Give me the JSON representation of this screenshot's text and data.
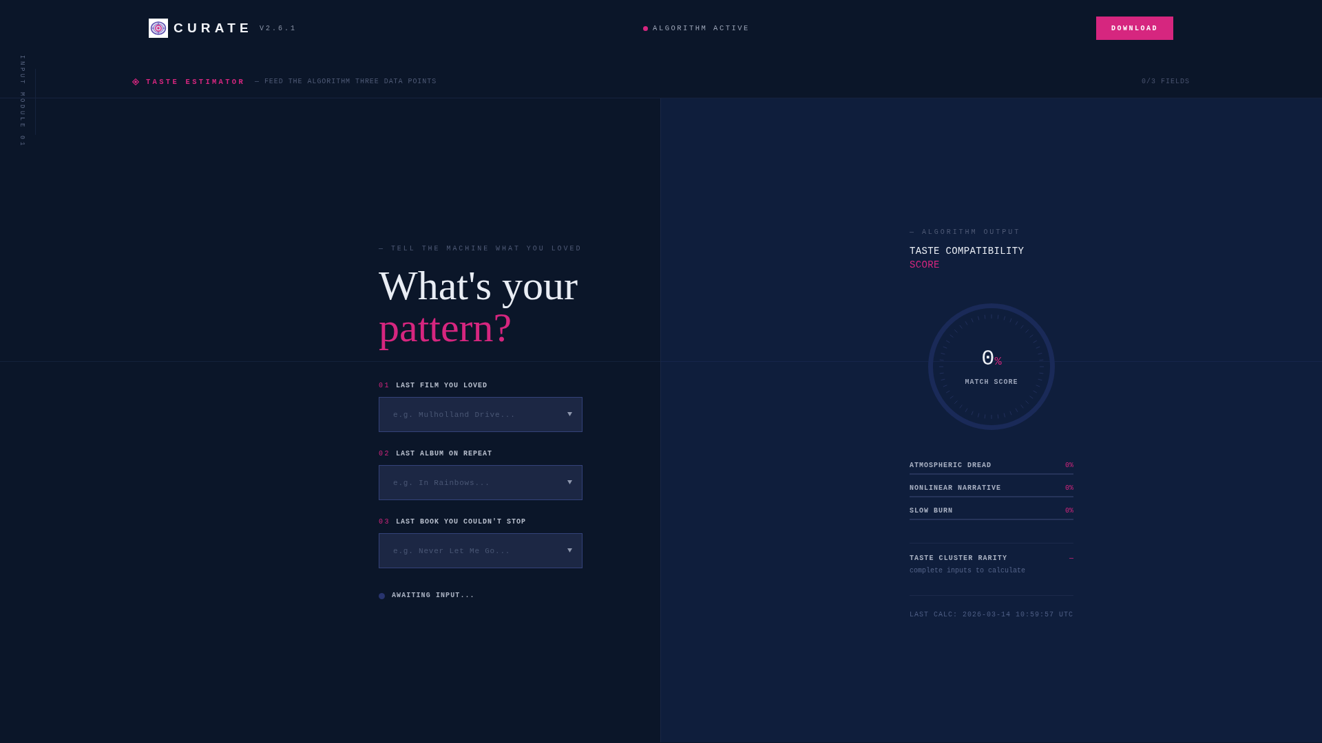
{
  "sidebar_label": "INPUT MODULE 01",
  "header": {
    "brand": "CURATE",
    "version": "V2.6.1",
    "status": {
      "label": "ALGORITHM ACTIVE",
      "active": true
    },
    "download_button": "DOWNLOAD"
  },
  "subheader": {
    "title": "TASTE ESTIMATOR",
    "subtitle": "— FEED THE ALGORITHM THREE DATA POINTS",
    "progress": "0/3 FIELDS"
  },
  "form": {
    "eyebrow": "— TELL THE MACHINE WHAT YOU LOVED",
    "heading": "What's your",
    "heading_accent": "pattern?",
    "fields": [
      {
        "number": "01",
        "label": "LAST FILM YOU LOVED",
        "placeholder": "e.g. Mulholland Drive..."
      },
      {
        "number": "02",
        "label": "LAST ALBUM ON REPEAT",
        "placeholder": "e.g. In Rainbows..."
      },
      {
        "number": "03",
        "label": "LAST BOOK YOU COULDN'T STOP",
        "placeholder": "e.g. Never Let Me Go..."
      }
    ],
    "status": {
      "label": "AWAITING INPUT...",
      "active": false
    }
  },
  "output": {
    "eyebrow": "— ALGORITHM OUTPUT",
    "title": "TASTE COMPATIBILITY",
    "title_accent": "SCORE",
    "gauge": {
      "value": "0",
      "unit": "%",
      "label": "MATCH SCORE"
    },
    "traits": [
      {
        "name": "ATMOSPHERIC DREAD",
        "reading": "0%"
      },
      {
        "name": "NONLINEAR NARRATIVE",
        "reading": "0%"
      },
      {
        "name": "SLOW BURN",
        "reading": "0%"
      }
    ],
    "rarity": {
      "label": "TASTE CLUSTER RARITY",
      "value": "—",
      "note": "complete inputs to calculate"
    },
    "last_calc": "LAST CALC: 2026-03-14 10:59:57 UTC"
  }
}
